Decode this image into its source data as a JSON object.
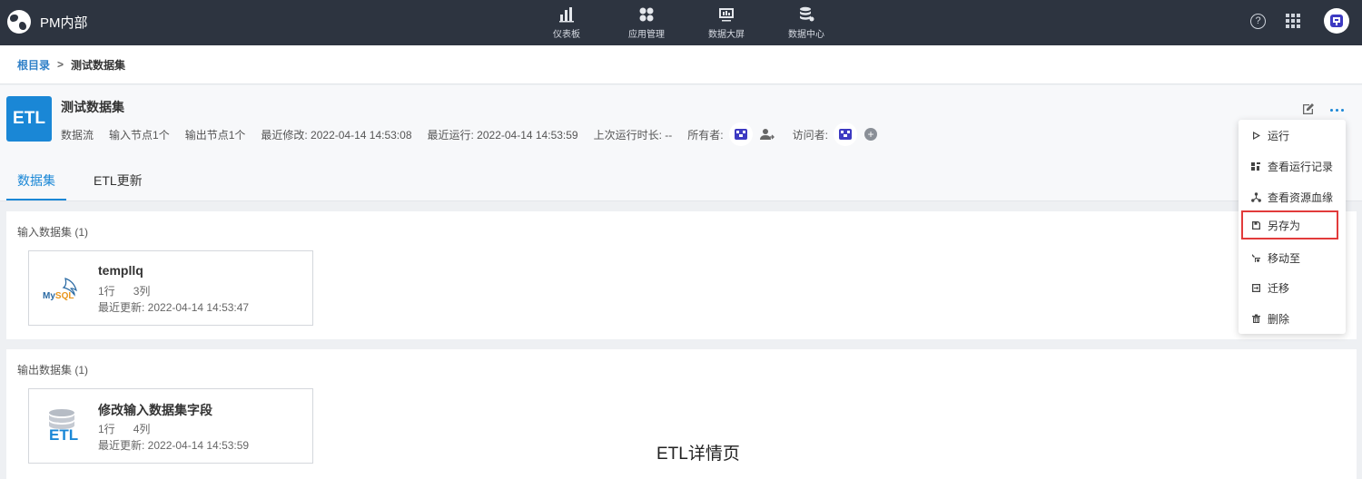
{
  "topbar": {
    "brand": "PM内部",
    "nav": [
      {
        "label": "仪表板",
        "icon": "bar-chart-icon"
      },
      {
        "label": "应用管理",
        "icon": "apps-grid-icon"
      },
      {
        "label": "数据大屏",
        "icon": "screen-icon"
      },
      {
        "label": "数据中心",
        "icon": "database-icon"
      }
    ],
    "help": "?"
  },
  "breadcrumb": {
    "root": "根目录",
    "separator": ">",
    "current": "测试数据集"
  },
  "dataset": {
    "logo": "ETL",
    "title": "测试数据集",
    "type": "数据流",
    "input_nodes": "输入节点1个",
    "output_nodes": "输出节点1个",
    "last_modified": "最近修改: 2022-04-14 14:53:08",
    "last_run": "最近运行: 2022-04-14 14:53:59",
    "last_duration": "上次运行时长: --",
    "owner_label": "所有者:",
    "visitor_label": "访问者:",
    "add": "+"
  },
  "tabs": [
    {
      "label": "数据集",
      "active": true
    },
    {
      "label": "ETL更新",
      "active": false
    }
  ],
  "input_section": {
    "label": "输入数据集 (1)",
    "card": {
      "name": "templlq",
      "rows": "1行",
      "cols": "3列",
      "updated": "最近更新: 2022-04-14 14:53:47",
      "icon": "mysql-icon",
      "logo_text_a": "My",
      "logo_text_b": "SQL"
    }
  },
  "output_section": {
    "label": "输出数据集 (1)",
    "card": {
      "name": "修改输入数据集字段",
      "rows": "1行",
      "cols": "4列",
      "updated": "最近更新: 2022-04-14 14:53:59",
      "icon": "etl-database-icon",
      "logo_text": "ETL"
    }
  },
  "menu": {
    "items": [
      {
        "label": "运行",
        "icon": "play-icon"
      },
      {
        "label": "查看运行记录",
        "icon": "history-icon"
      },
      {
        "label": "查看资源血缘",
        "icon": "lineage-icon"
      },
      {
        "label": "另存为",
        "icon": "save-as-icon",
        "highlighted": true
      },
      {
        "label": "移动至",
        "icon": "move-icon"
      },
      {
        "label": "迁移",
        "icon": "migrate-icon"
      },
      {
        "label": "删除",
        "icon": "trash-icon"
      }
    ]
  },
  "caption": "ETL详情页",
  "colors": {
    "topbar": "#2d3440",
    "accent": "#1a87d6",
    "highlight_border": "#e23b3b"
  }
}
